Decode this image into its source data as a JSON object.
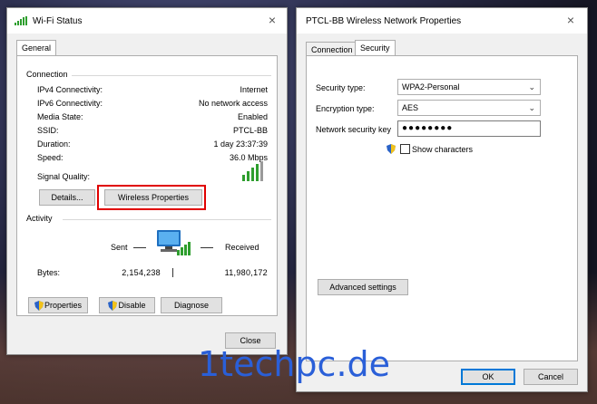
{
  "wifi_status": {
    "title": "Wi-Fi Status",
    "close_glyph": "×",
    "tab_general": "General",
    "connection": {
      "heading": "Connection",
      "rows": [
        {
          "label": "IPv4 Connectivity:",
          "value": "Internet"
        },
        {
          "label": "IPv6 Connectivity:",
          "value": "No network access"
        },
        {
          "label": "Media State:",
          "value": "Enabled"
        },
        {
          "label": "SSID:",
          "value": "PTCL-BB"
        },
        {
          "label": "Duration:",
          "value": "1 day 23:37:39"
        },
        {
          "label": "Speed:",
          "value": "36.0 Mbps"
        }
      ],
      "signal_label": "Signal Quality:",
      "signal_icon": "signal-bars-icon"
    },
    "details_button": "Details...",
    "wireless_properties_button": "Wireless Properties",
    "activity": {
      "heading": "Activity",
      "sent_label": "Sent",
      "received_label": "Received",
      "bytes_label": "Bytes:",
      "bytes_sent": "2,154,238",
      "bytes_received": "11,980,172",
      "network_icon": "network-computer-icon"
    },
    "properties_button": "Properties",
    "disable_button": "Disable",
    "diagnose_button": "Diagnose",
    "close_button": "Close"
  },
  "wireless_props": {
    "title": "PTCL-BB Wireless Network Properties",
    "close_glyph": "×",
    "tab_connection": "Connection",
    "tab_security": "Security",
    "security_type_label": "Security type:",
    "security_type_value": "WPA2-Personal",
    "encryption_type_label": "Encryption type:",
    "encryption_type_value": "AES",
    "network_key_label": "Network security key",
    "network_key_value": "●●●●●●●●",
    "show_characters_label": "Show characters",
    "advanced_settings_button": "Advanced settings",
    "ok_button": "OK",
    "cancel_button": "Cancel"
  },
  "watermark": "1techpc.de",
  "colors": {
    "accent_blue": "#0078d7",
    "highlight_red": "#e00000",
    "signal_green": "#2e9e2e",
    "watermark_blue": "#2a5fd8"
  }
}
